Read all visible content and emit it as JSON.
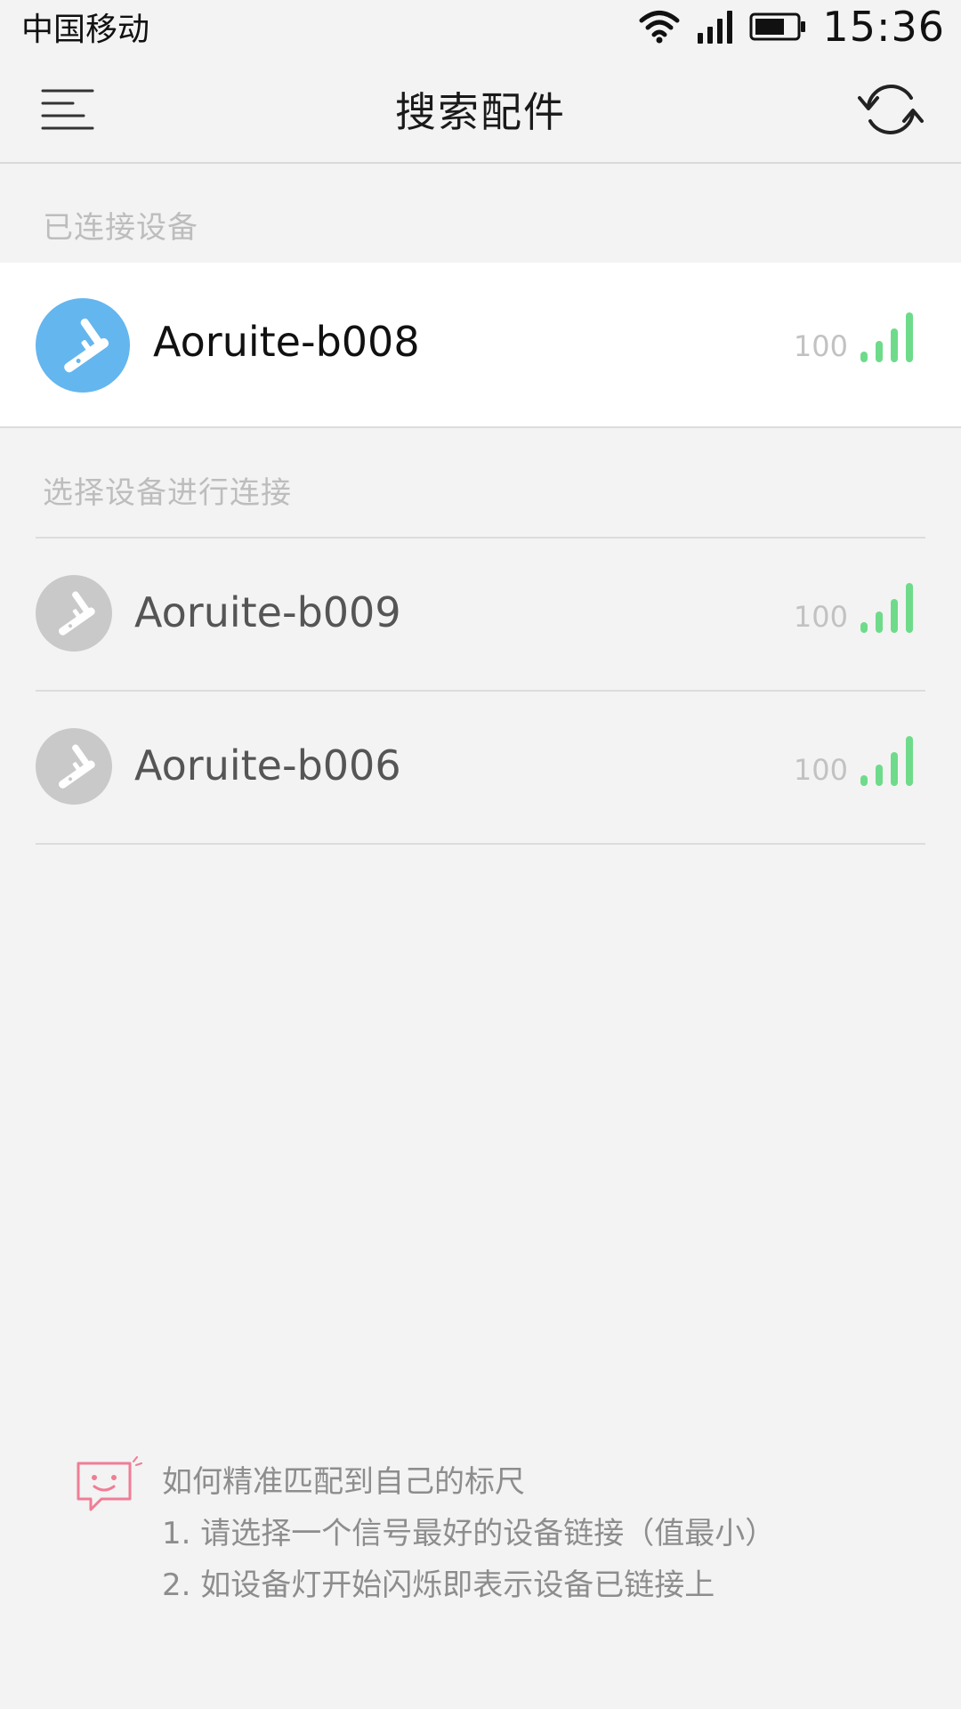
{
  "status_bar": {
    "carrier": "中国移动",
    "time": "15:36",
    "icons": [
      "wifi-icon",
      "cell-signal-icon",
      "battery-icon"
    ]
  },
  "nav": {
    "title": "搜索配件",
    "menu_icon": "menu-icon",
    "refresh_icon": "refresh-icon"
  },
  "connected": {
    "header": "已连接设备",
    "device": {
      "name": "Aoruite-b008",
      "signal": "100"
    }
  },
  "available": {
    "header": "选择设备进行连接",
    "devices": [
      {
        "name": "Aoruite-b009",
        "signal": "100"
      },
      {
        "name": "Aoruite-b006",
        "signal": "100"
      }
    ]
  },
  "tips": {
    "icon": "chat-smiley-icon",
    "title": "如何精准匹配到自己的标尺",
    "line1": "1. 请选择一个信号最好的设备链接（值最小）",
    "line2": "2. 如设备灯开始闪烁即表示设备已链接上"
  },
  "colors": {
    "accent_blue": "#64b6ee",
    "signal_green": "#6edb8b",
    "inactive_gray": "#c9c9c9",
    "tip_pink": "#ef7d95"
  }
}
